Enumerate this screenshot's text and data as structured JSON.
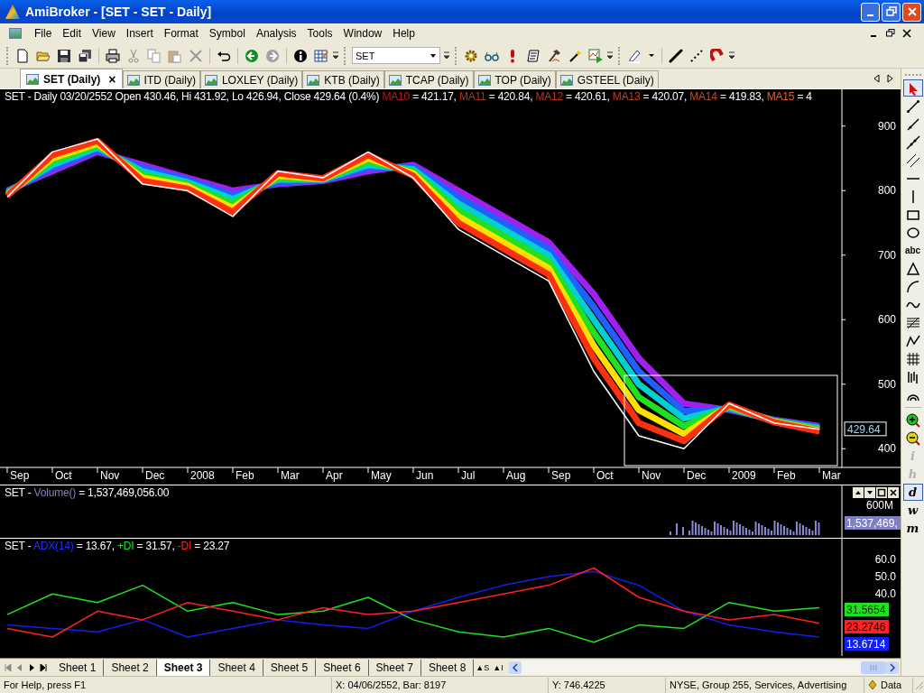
{
  "window": {
    "title": "AmiBroker - [SET - SET - Daily]"
  },
  "menu": [
    "File",
    "Edit",
    "View",
    "Insert",
    "Format",
    "Symbol",
    "Analysis",
    "Tools",
    "Window",
    "Help"
  ],
  "symbol_combo": {
    "value": "SET"
  },
  "document_tabs": [
    {
      "label": "SET (Daily)",
      "selected": true,
      "close": "×"
    },
    {
      "label": "ITD (Daily)",
      "selected": false
    },
    {
      "label": "LOXLEY (Daily)",
      "selected": false
    },
    {
      "label": "KTB (Daily)",
      "selected": false
    },
    {
      "label": "TCAP (Daily)",
      "selected": false
    },
    {
      "label": "TOP (Daily)",
      "selected": false
    },
    {
      "label": "GSTEEL (Daily)",
      "selected": false
    }
  ],
  "price_pane": {
    "header": [
      {
        "text": "SET - Daily 03/20/2552 Open 430.46, Hi 431.92, Lo 426.94, Close 429.64 (0.4%) ",
        "color": "#ffffff"
      },
      {
        "text": "MA10",
        "color": "#b02020"
      },
      {
        "text": " = 421.17, ",
        "color": "#ffffff"
      },
      {
        "text": "MA11",
        "color": "#b03018"
      },
      {
        "text": " = 420.84, ",
        "color": "#ffffff"
      },
      {
        "text": "MA12",
        "color": "#b83a20"
      },
      {
        "text": " = 420.61, ",
        "color": "#ffffff"
      },
      {
        "text": "MA13",
        "color": "#c04020"
      },
      {
        "text": " = 420.07, ",
        "color": "#ffffff"
      },
      {
        "text": "MA14",
        "color": "#c84a28"
      },
      {
        "text": " = 419.83, ",
        "color": "#ffffff"
      },
      {
        "text": "MA15",
        "color": "#e06030"
      },
      {
        "text": " = 4",
        "color": "#ffffff"
      }
    ],
    "last_value": "429.64",
    "chart_data": {
      "type": "line",
      "categories": [
        "Sep",
        "Oct",
        "Nov",
        "Dec",
        "2008",
        "Feb",
        "Mar",
        "Apr",
        "May",
        "Jun",
        "Jul",
        "Aug",
        "Sep",
        "Oct",
        "Nov",
        "Dec",
        "2009",
        "Feb",
        "Mar"
      ],
      "ylim": [
        371,
        957
      ],
      "yticks": [
        400,
        500,
        600,
        700,
        800,
        900
      ],
      "series": [
        {
          "color": "#a020f0",
          "values": [
            800,
            830,
            860,
            840,
            820,
            800,
            810,
            815,
            830,
            840,
            800,
            760,
            720,
            640,
            540,
            470,
            460,
            445,
            435
          ]
        },
        {
          "color": "#2060ff",
          "values": [
            798,
            835,
            863,
            835,
            817,
            793,
            813,
            816,
            835,
            837,
            790,
            750,
            710,
            620,
            520,
            458,
            462,
            444,
            433
          ]
        },
        {
          "color": "#00d0d0",
          "values": [
            797,
            840,
            867,
            830,
            813,
            787,
            817,
            817,
            840,
            833,
            780,
            740,
            700,
            600,
            500,
            447,
            463,
            443,
            432
          ]
        },
        {
          "color": "#20e020",
          "values": [
            795,
            845,
            870,
            825,
            810,
            780,
            820,
            818,
            845,
            830,
            770,
            730,
            690,
            580,
            480,
            435,
            465,
            443,
            430
          ]
        },
        {
          "color": "#ffe000",
          "values": [
            793,
            850,
            873,
            820,
            807,
            773,
            823,
            818,
            850,
            827,
            760,
            720,
            680,
            560,
            460,
            423,
            467,
            442,
            428
          ]
        },
        {
          "color": "#ff3010",
          "values": [
            792,
            855,
            877,
            815,
            803,
            767,
            827,
            819,
            855,
            823,
            750,
            710,
            670,
            540,
            440,
            412,
            468,
            441,
            427
          ]
        },
        {
          "color": "#ffffff",
          "values": [
            790,
            860,
            880,
            810,
            800,
            760,
            830,
            820,
            860,
            820,
            740,
            700,
            660,
            520,
            420,
            400,
            470,
            440,
            430
          ]
        }
      ]
    }
  },
  "volume_pane": {
    "header": [
      {
        "text": "SET - ",
        "color": "#ffffff"
      },
      {
        "text": "Volume()",
        "color": "#8080c0"
      },
      {
        "text": " = 1,537,469,056.00",
        "color": "#ffffff"
      }
    ],
    "axis_label": "600M",
    "last_value": "1,537,469,"
  },
  "adx_pane": {
    "header": [
      {
        "text": "SET - ",
        "color": "#ffffff"
      },
      {
        "text": "ADX(14)",
        "color": "#2030ff"
      },
      {
        "text": " = 13.67, ",
        "color": "#ffffff"
      },
      {
        "text": "+DI",
        "color": "#20e020"
      },
      {
        "text": " = 31.57, ",
        "color": "#ffffff"
      },
      {
        "text": "-DI",
        "color": "#ff2020"
      },
      {
        "text": " = 23.27",
        "color": "#ffffff"
      }
    ],
    "readouts": [
      {
        "text": "31.5654",
        "color": "#20e020"
      },
      {
        "text": "23.2746",
        "color": "#ff2020"
      },
      {
        "text": "13.6714",
        "color": "#1020f0"
      }
    ],
    "chart_data": {
      "type": "line",
      "ylim": [
        4,
        72
      ],
      "yticks": [
        {
          "value": 40,
          "label": "40.0"
        },
        {
          "value": 50,
          "label": "50.0"
        },
        {
          "value": 60,
          "label": "60.0"
        }
      ],
      "series": [
        {
          "color": "#1020f0",
          "values": [
            22,
            20,
            18,
            25,
            15,
            20,
            25,
            22,
            20,
            30,
            38,
            45,
            50,
            53,
            45,
            30,
            22,
            18,
            15
          ]
        },
        {
          "color": "#20e020",
          "values": [
            28,
            40,
            35,
            45,
            30,
            35,
            28,
            30,
            38,
            25,
            18,
            15,
            20,
            12,
            22,
            20,
            35,
            30,
            32
          ]
        },
        {
          "color": "#ff2020",
          "values": [
            20,
            15,
            30,
            25,
            35,
            30,
            25,
            32,
            28,
            30,
            35,
            40,
            45,
            55,
            38,
            30,
            25,
            28,
            23
          ]
        }
      ]
    }
  },
  "interval_buttons": [
    {
      "label": "i",
      "disabled": true,
      "selected": false
    },
    {
      "label": "h",
      "disabled": true,
      "selected": false
    },
    {
      "label": "d",
      "disabled": false,
      "selected": true
    },
    {
      "label": "w",
      "disabled": false,
      "selected": false
    },
    {
      "label": "m",
      "disabled": false,
      "selected": false
    }
  ],
  "text_tool": "abc",
  "sheet_tabs": [
    {
      "label": "Sheet 1",
      "selected": false
    },
    {
      "label": "Sheet 2",
      "selected": false
    },
    {
      "label": "Sheet 3",
      "selected": true
    },
    {
      "label": "Sheet 4",
      "selected": false
    },
    {
      "label": "Sheet 5",
      "selected": false
    },
    {
      "label": "Sheet 6",
      "selected": false
    },
    {
      "label": "Sheet 7",
      "selected": false
    },
    {
      "label": "Sheet 8",
      "selected": false
    }
  ],
  "sheet_controls": [
    "▲S",
    "▲I"
  ],
  "status_bar": {
    "help": "For Help, press F1",
    "x": "X: 04/06/2552, Bar: 8197",
    "y": "Y: 746.4225",
    "info": "NYSE, Group 255, Services, Advertising",
    "data": "Data"
  }
}
